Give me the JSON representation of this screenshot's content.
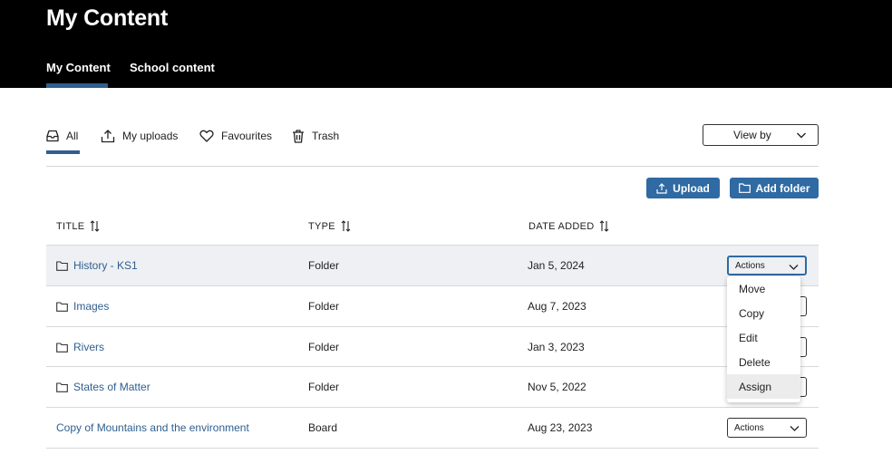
{
  "header": {
    "title": "My Content",
    "tabs": [
      {
        "label": "My Content",
        "active": true
      },
      {
        "label": "School content",
        "active": false
      }
    ]
  },
  "filters": {
    "tabs": [
      {
        "label": "All",
        "icon": "inbox-icon",
        "active": true
      },
      {
        "label": "My uploads",
        "icon": "upload-icon"
      },
      {
        "label": "Favourites",
        "icon": "heart-icon"
      },
      {
        "label": "Trash",
        "icon": "trash-icon"
      }
    ],
    "view_by": "View by"
  },
  "toolbar": {
    "upload_label": "Upload",
    "add_folder_label": "Add folder"
  },
  "table": {
    "columns": [
      "TITLE",
      "TYPE",
      "DATE ADDED"
    ],
    "rows": [
      {
        "title": "History - KS1",
        "type": "Folder",
        "date": "Jan 5, 2024",
        "icon": "folder-icon"
      },
      {
        "title": "Images",
        "type": "Folder",
        "date": "Aug 7, 2023",
        "icon": "folder-icon"
      },
      {
        "title": "Rivers",
        "type": "Folder",
        "date": "Jan 3, 2023",
        "icon": "folder-icon"
      },
      {
        "title": "States of Matter",
        "type": "Folder",
        "date": "Nov 5, 2022",
        "icon": "folder-icon"
      },
      {
        "title": "Copy of Mountains and the environment",
        "type": "Board",
        "date": "Aug 23, 2023",
        "icon": ""
      }
    ],
    "actions_label": "Actions"
  },
  "actions_menu": {
    "items": [
      "Move",
      "Copy",
      "Edit",
      "Delete",
      "Assign"
    ],
    "highlighted": "Assign"
  },
  "colors": {
    "header_bg": "#000000",
    "accent": "#2f6aa3",
    "link": "#2f5f8f",
    "selected_row": "#eef0f3"
  }
}
